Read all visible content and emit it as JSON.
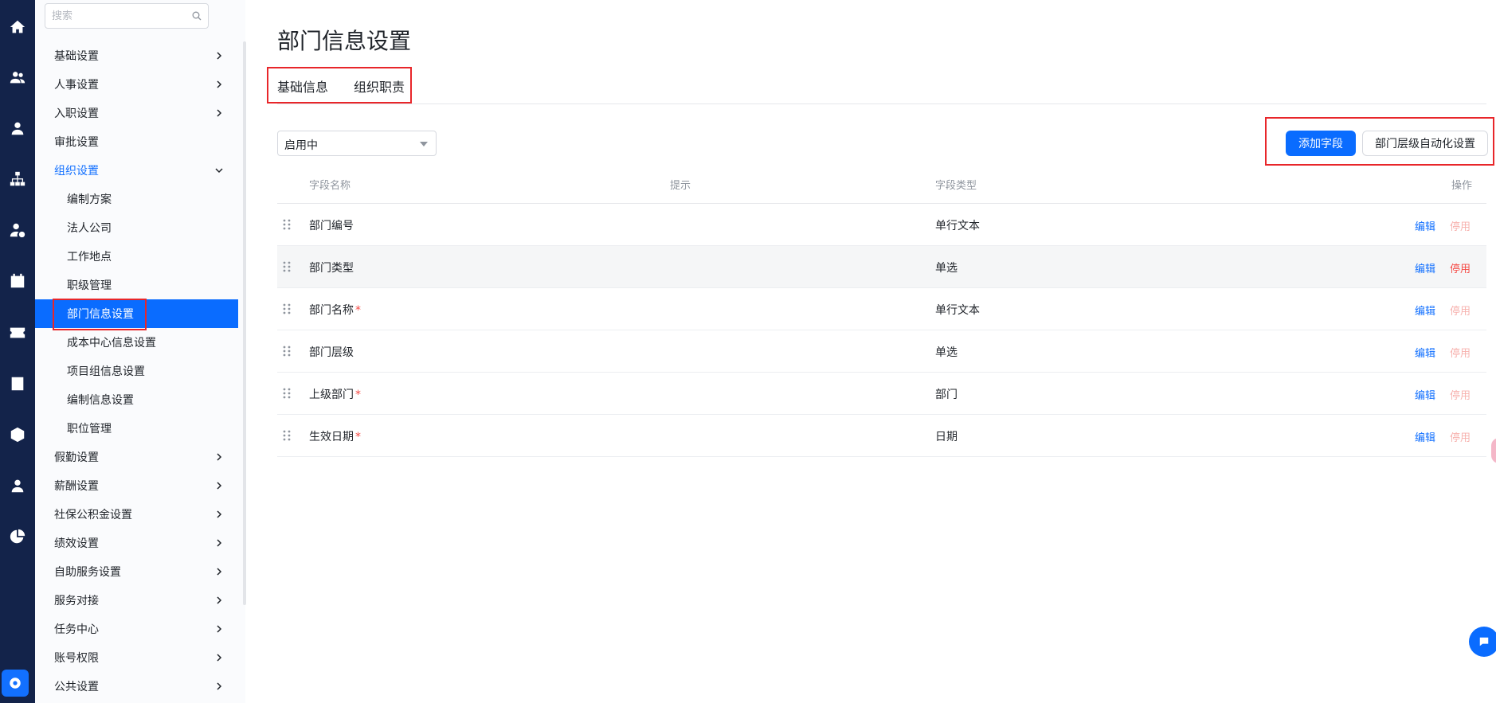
{
  "sidebar": {
    "search_placeholder": "搜索",
    "items": [
      {
        "label": "基础设置"
      },
      {
        "label": "人事设置"
      },
      {
        "label": "入职设置"
      },
      {
        "label": "审批设置"
      },
      {
        "label": "组织设置"
      },
      {
        "label": "编制方案"
      },
      {
        "label": "法人公司"
      },
      {
        "label": "工作地点"
      },
      {
        "label": "职级管理"
      },
      {
        "label": "部门信息设置"
      },
      {
        "label": "成本中心信息设置"
      },
      {
        "label": "项目组信息设置"
      },
      {
        "label": "编制信息设置"
      },
      {
        "label": "职位管理"
      },
      {
        "label": "假勤设置"
      },
      {
        "label": "薪酬设置"
      },
      {
        "label": "社保公积金设置"
      },
      {
        "label": "绩效设置"
      },
      {
        "label": "自助服务设置"
      },
      {
        "label": "服务对接"
      },
      {
        "label": "任务中心"
      },
      {
        "label": "账号权限"
      },
      {
        "label": "公共设置"
      }
    ]
  },
  "rail_icons": [
    "home-icon",
    "people-icon",
    "person-icon",
    "org-chart-icon",
    "person-settings-icon",
    "calendar-icon",
    "ticket-icon",
    "report-icon",
    "cube-icon",
    "user-icon",
    "pie-chart-icon",
    "settings-icon"
  ],
  "main": {
    "title": "部门信息设置",
    "tabs": [
      {
        "label": "基础信息"
      },
      {
        "label": "组织职责"
      }
    ],
    "status_select": "启用中",
    "add_field_button": "添加字段",
    "auto_level_button": "部门层级自动化设置",
    "table": {
      "headers": [
        "字段名称",
        "提示",
        "字段类型",
        "操作"
      ],
      "rows": [
        {
          "name": "部门编号",
          "required": "",
          "type": "单行文本",
          "edit": "编辑",
          "disable": "停用"
        },
        {
          "name": "部门类型",
          "required": "",
          "type": "单选",
          "edit": "编辑",
          "disable": "停用"
        },
        {
          "name": "部门名称",
          "required": "*",
          "type": "单行文本",
          "edit": "编辑",
          "disable": "停用"
        },
        {
          "name": "部门层级",
          "required": "",
          "type": "单选",
          "edit": "编辑",
          "disable": "停用"
        },
        {
          "name": "上级部门",
          "required": "*",
          "type": "部门",
          "edit": "编辑",
          "disable": "停用"
        },
        {
          "name": "生效日期",
          "required": "*",
          "type": "日期",
          "edit": "编辑",
          "disable": "停用"
        }
      ]
    }
  },
  "colors": {
    "rail_bg": "#13234a",
    "accent": "#1270ff",
    "highlight_box": "#e8262a",
    "danger": "#f54a45"
  }
}
